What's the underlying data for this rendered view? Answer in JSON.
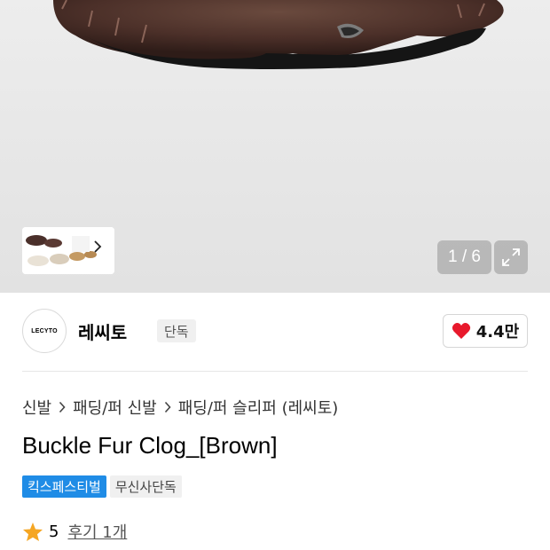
{
  "gallery": {
    "counter": "1 / 6",
    "image_description_icon": "fur-clog-image"
  },
  "brand": {
    "logo_text": "LECYTO",
    "name": "레씨토",
    "badge": "단독",
    "likes": "4.4만"
  },
  "breadcrumb": [
    "신발",
    "패딩/퍼 신발",
    "패딩/퍼 슬리퍼 (레씨토)"
  ],
  "product": {
    "title": "Buckle Fur Clog_[Brown]",
    "tags": [
      "킥스페스티벌",
      "무신사단독"
    ]
  },
  "rating": {
    "score": "5",
    "review_label": "후기 1개"
  },
  "colors": {
    "tag_blue": "#1f8ce6",
    "heart": "#e8192c",
    "star": "#f5a623"
  }
}
